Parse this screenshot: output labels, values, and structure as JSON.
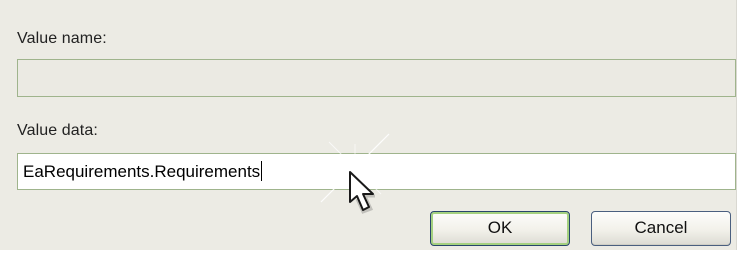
{
  "dialog": {
    "value_name_label": "Value name:",
    "value_name": "",
    "value_data_label": "Value data:",
    "value_data": "EaRequirements.Requirements",
    "ok_label": "OK",
    "cancel_label": "Cancel"
  },
  "icons": {
    "pointer": "mouse-pointer-icon",
    "highlight": "click-highlight-icon"
  },
  "colors": {
    "dialog_background": "#ecebe4",
    "field_border": "#9fb48c",
    "default_button_highlight": "#a4d180"
  }
}
